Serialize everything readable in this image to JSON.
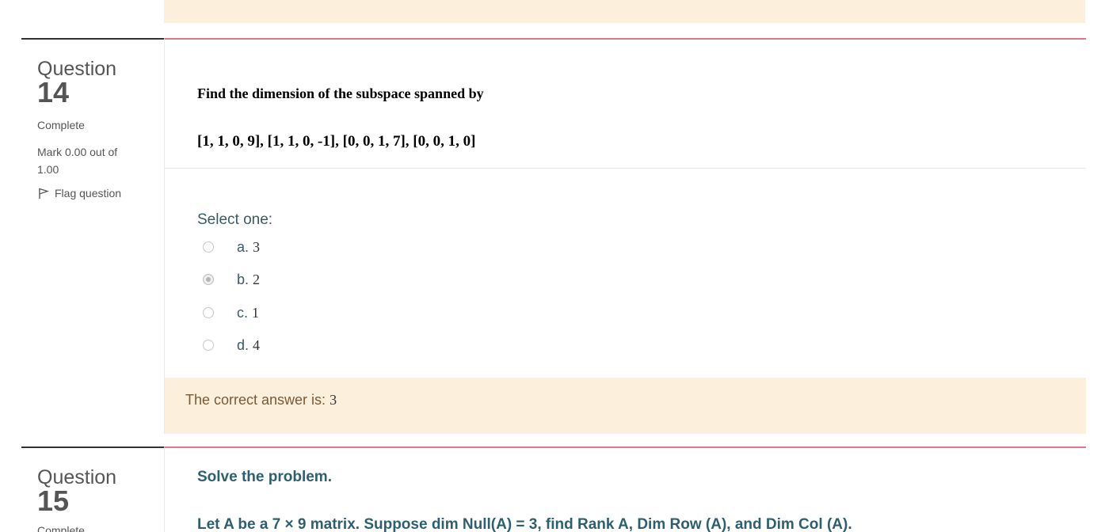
{
  "q14": {
    "label": "Question",
    "number": "14",
    "state": "Complete",
    "grade": "Mark 0.00 out of 1.00",
    "flag_label": "Flag question",
    "text_line1": "Find the dimension of the subspace spanned by",
    "text_line2": "[1, 1, 0, 9], [1, 1, 0, -1], [0, 0, 1, 7], [0, 0, 1, 0]",
    "prompt": "Select one:",
    "options": [
      {
        "letter": "a.",
        "value": "3",
        "checked": false
      },
      {
        "letter": "b.",
        "value": "2",
        "checked": true
      },
      {
        "letter": "c.",
        "value": "1",
        "checked": false
      },
      {
        "letter": "d.",
        "value": "4",
        "checked": false
      }
    ],
    "feedback_prefix": "The correct answer is:",
    "feedback_answer": "3"
  },
  "q15": {
    "label": "Question",
    "number": "15",
    "state": "Complete",
    "text_line1": "Solve the problem.",
    "text_line2": "Let A be a 7 × 9 matrix. Suppose dim Null(A) = 3, find Rank A, Dim Row (A), and Dim Col (A)."
  },
  "colors": {
    "accent_border": "#e0768a",
    "feedback_bg": "#fcefdc",
    "text_teal": "#3a5a66"
  }
}
